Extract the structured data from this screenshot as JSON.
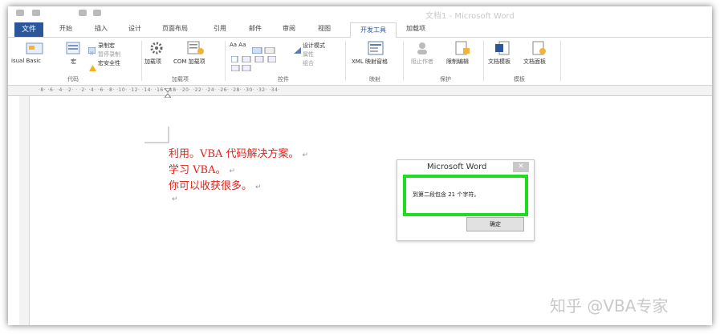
{
  "window": {
    "title": "文档1 - Microsoft Word"
  },
  "tabs": {
    "file": "文件",
    "items": [
      "开始",
      "插入",
      "设计",
      "页面布局",
      "引用",
      "邮件",
      "审阅",
      "视图"
    ],
    "active": "开发工具",
    "after": "加载项"
  },
  "ribbon": {
    "code": {
      "visual_basic": "isual Basic",
      "macros": "宏",
      "record_macro": "录制宏",
      "pause_recording": "暂停录制",
      "macro_security": "宏安全性",
      "label": "代码"
    },
    "addins": {
      "addins": "加载项",
      "com_addins": "COM 加载项",
      "label": "加载项"
    },
    "controls": {
      "design_mode": "设计模式",
      "properties": "属性",
      "group": "组合",
      "label": "控件"
    },
    "mapping": {
      "xml_pane": "XML 映射窗格",
      "label": "映射"
    },
    "protect": {
      "block_authors": "阻止作者",
      "restrict_editing": "限制编辑",
      "label": "保护"
    },
    "templates": {
      "document_template": "文档模板",
      "document_panel": "文档面板",
      "label": "模板"
    }
  },
  "ruler": {
    "ticks": "·8· ·6· ·4· ·2· · ·2· ·4· ·6· ·8· ·10· ·12· ·14· ·16· ·18· ·20· ·22· ·24· ·26· ·28· ·30· ·32· ·34·"
  },
  "document": {
    "lines": [
      "利用。VBA 代码解决方案。",
      "学习 VBA。",
      "你可以收获很多。"
    ],
    "paragraph_mark": "↵"
  },
  "dialog": {
    "title": "Microsoft Word",
    "message": "到第二段包含 21 个字符。",
    "ok": "确定",
    "highlight_color": "#1fdc1f"
  },
  "watermark": "知乎 @VBA专家",
  "colors": {
    "accent": "#2b579a",
    "doc_text": "#e0241c"
  }
}
